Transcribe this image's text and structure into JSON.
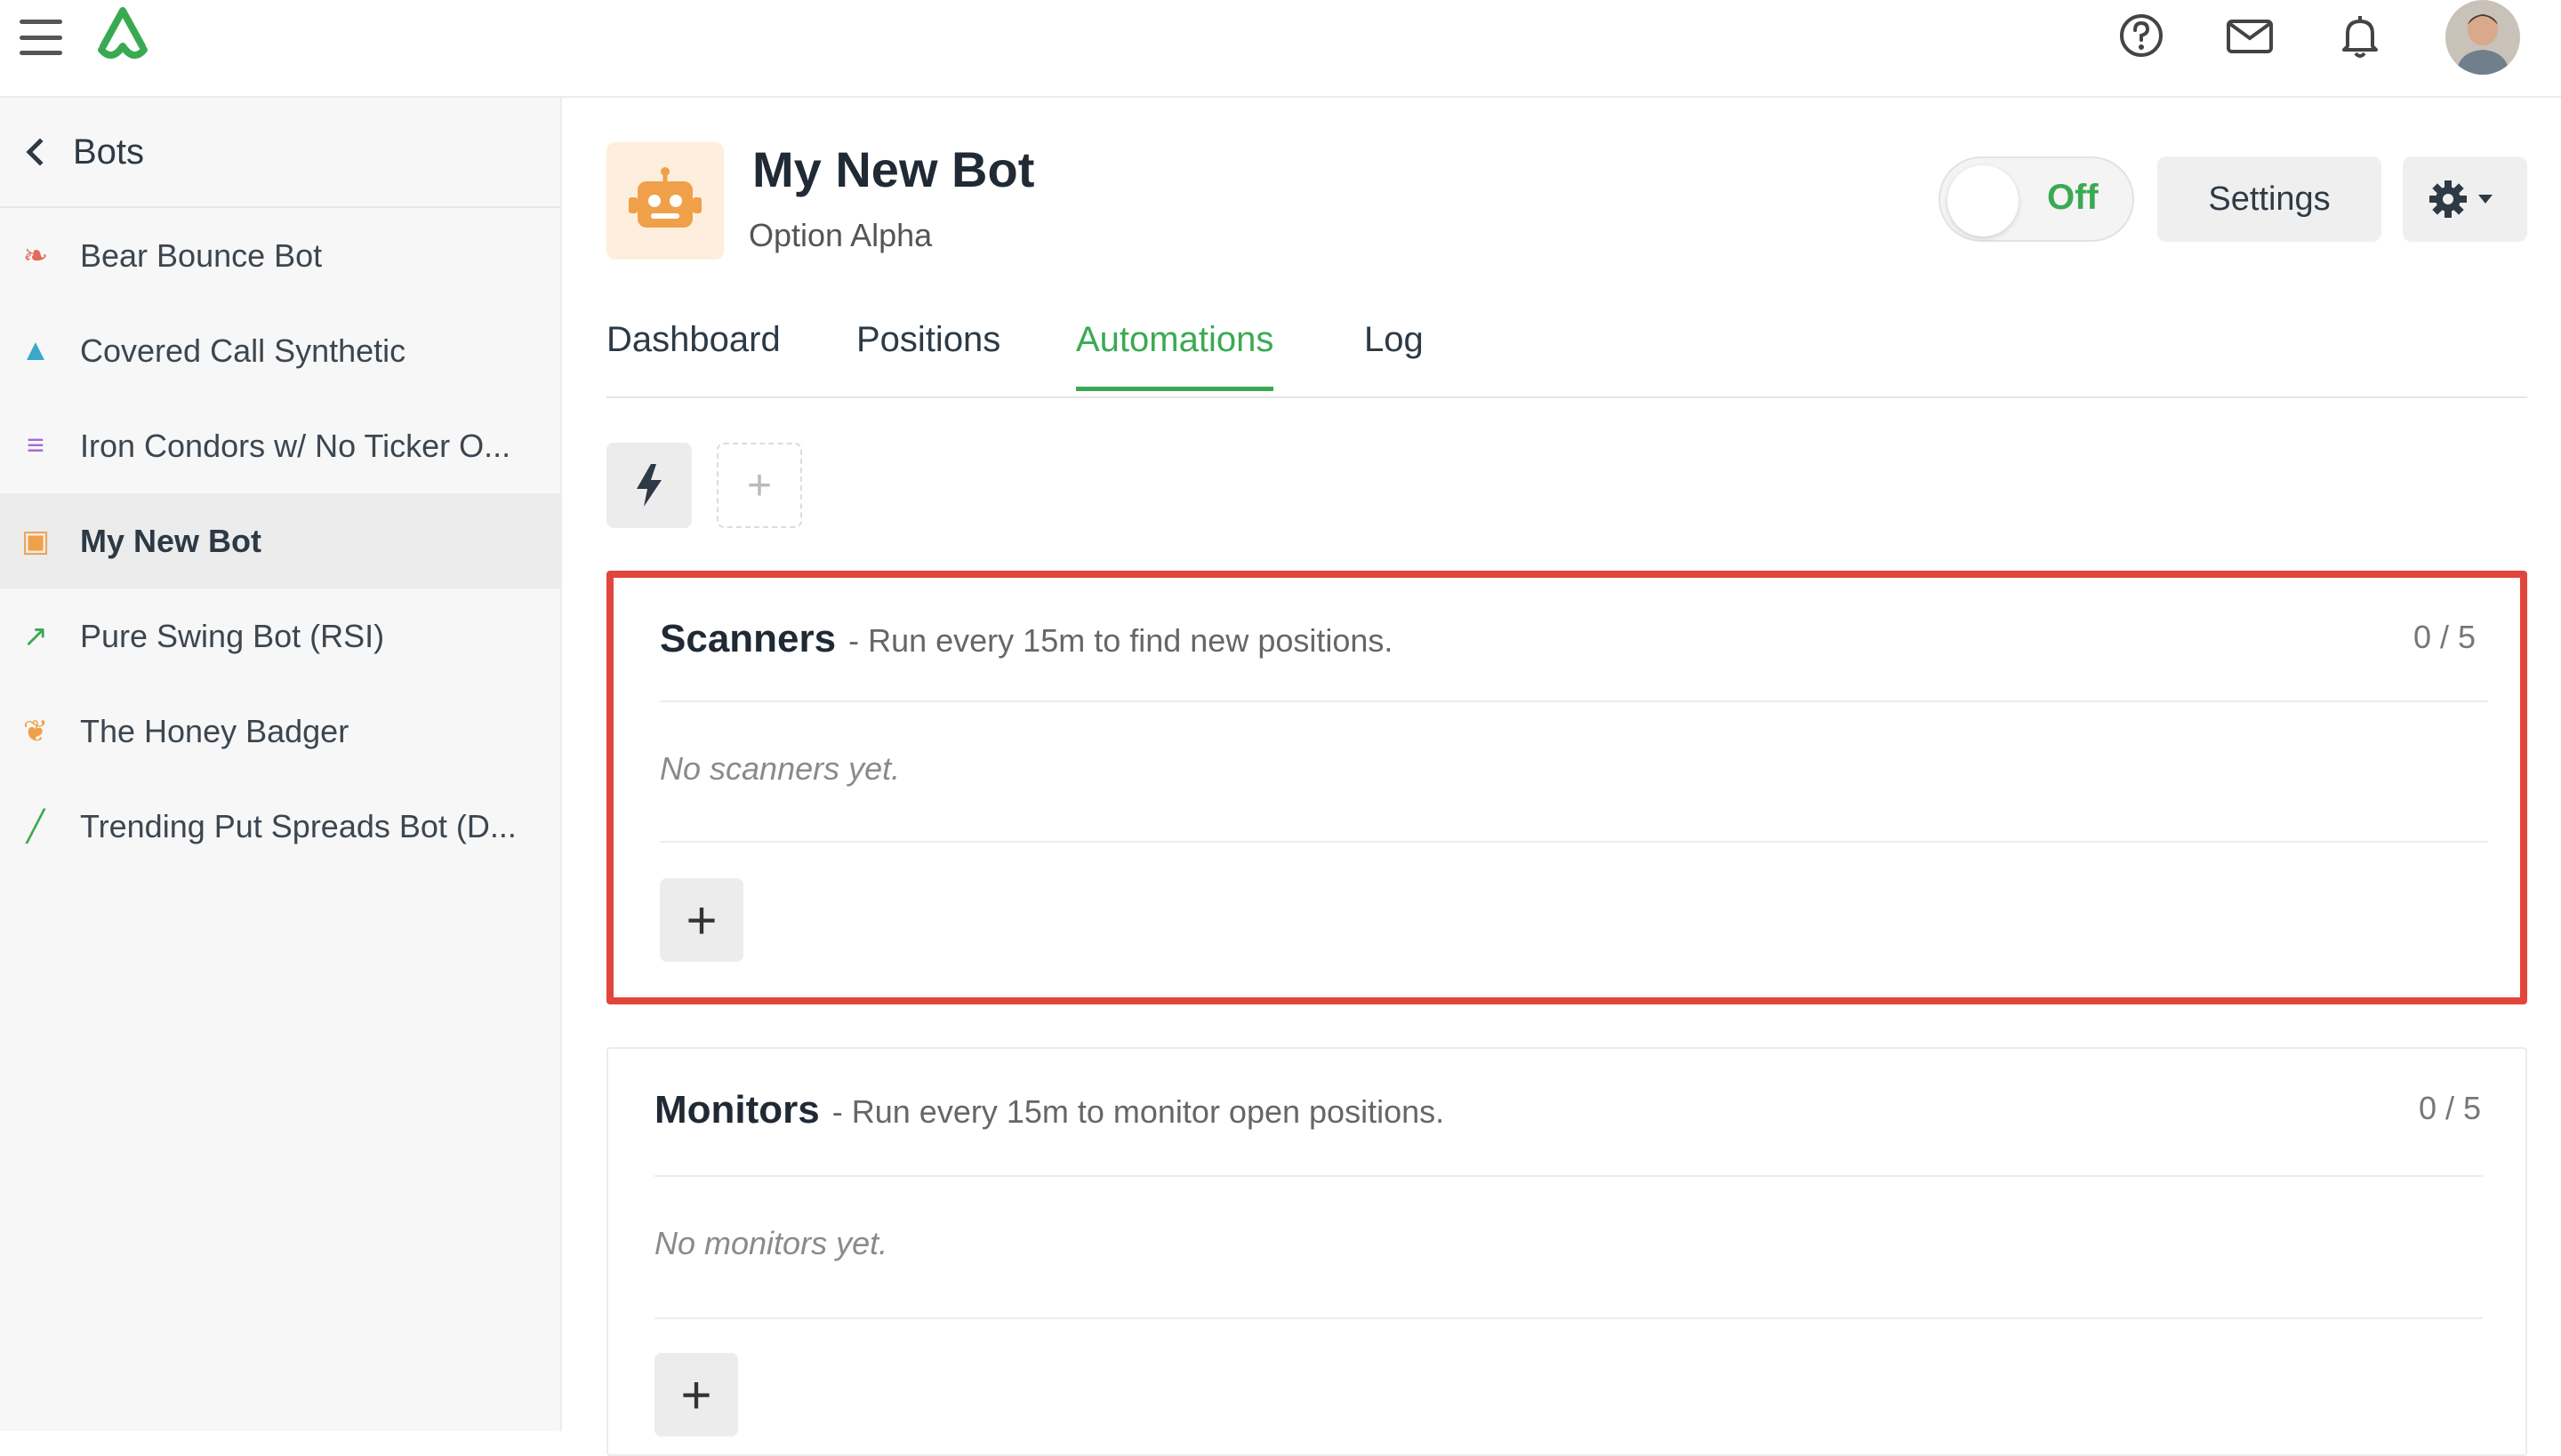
{
  "topbar": {
    "icons": [
      "menu-icon",
      "logo-icon",
      "help-icon",
      "mail-icon",
      "bell-icon",
      "avatar"
    ]
  },
  "sidebar": {
    "title": "Bots",
    "items": [
      {
        "label": "Bear Bounce Bot",
        "icon": "paw-icon",
        "color": "#e06b5a"
      },
      {
        "label": "Covered Call Synthetic",
        "icon": "triangle-icon",
        "color": "#3aa9c9"
      },
      {
        "label": "Iron Condors w/ No Ticker O...",
        "icon": "condor-icon",
        "color": "#a56ad0"
      },
      {
        "label": "My New Bot",
        "icon": "robot-icon",
        "color": "#f0a048"
      },
      {
        "label": "Pure Swing Bot (RSI)",
        "icon": "rocket-icon",
        "color": "#3aaa52"
      },
      {
        "label": "The Honey Badger",
        "icon": "badger-icon",
        "color": "#f0a048"
      },
      {
        "label": "Trending Put Spreads Bot (D...",
        "icon": "chart-icon",
        "color": "#3aaa52"
      }
    ],
    "active_index": 3
  },
  "header": {
    "bot_name": "My New Bot",
    "owner": "Option Alpha",
    "toggle_label": "Off",
    "settings_label": "Settings"
  },
  "tabs": [
    "Dashboard",
    "Positions",
    "Automations",
    "Log"
  ],
  "active_tab": "Automations",
  "sections": {
    "scanners": {
      "title": "Scanners",
      "desc": "- Run every 15m to find new positions.",
      "count": "0 / 5",
      "empty": "No scanners yet.",
      "add": "+"
    },
    "monitors": {
      "title": "Monitors",
      "desc": "- Run every 15m to monitor open positions.",
      "count": "0 / 5",
      "empty": "No monitors yet.",
      "add": "+"
    }
  },
  "add_trigger": "+",
  "colors": {
    "accent": "#3aaa52",
    "highlight": "#e2453c"
  }
}
